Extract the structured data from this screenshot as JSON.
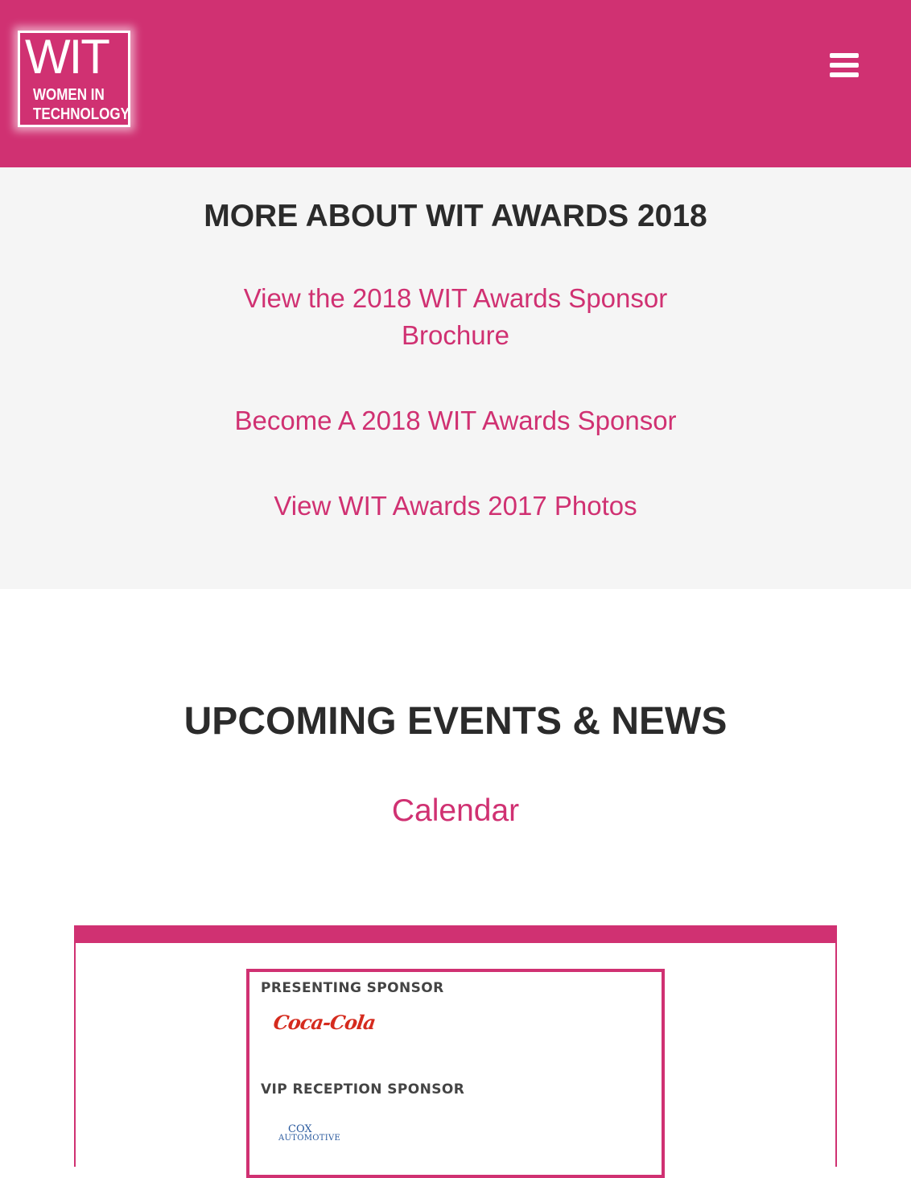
{
  "header": {
    "logo_mark": "WIT",
    "logo_line1": "WOMEN IN",
    "logo_line2": "TECHNOLOGY",
    "menu_icon": "hamburger-menu-icon"
  },
  "about": {
    "title": "MORE ABOUT WIT AWARDS 2018",
    "links": [
      "View the 2018 WIT Awards Sponsor Brochure",
      "Become A 2018 WIT Awards Sponsor",
      "View WIT Awards 2017 Photos"
    ]
  },
  "events": {
    "title": "UPCOMING EVENTS & NEWS",
    "calendar_link": "Calendar"
  },
  "sponsors": {
    "presenting_label": "PRESENTING SPONSOR",
    "presenting_logo_text": "Coca-Cola",
    "vip_label": "VIP RECEPTION SPONSOR",
    "vip_logo_line1": "COX",
    "vip_logo_line2": "AUTOMOTIVE"
  },
  "colors": {
    "brand_pink": "#d03172",
    "heading_text": "#2b2b2b",
    "section_background": "#f5f5f5"
  }
}
